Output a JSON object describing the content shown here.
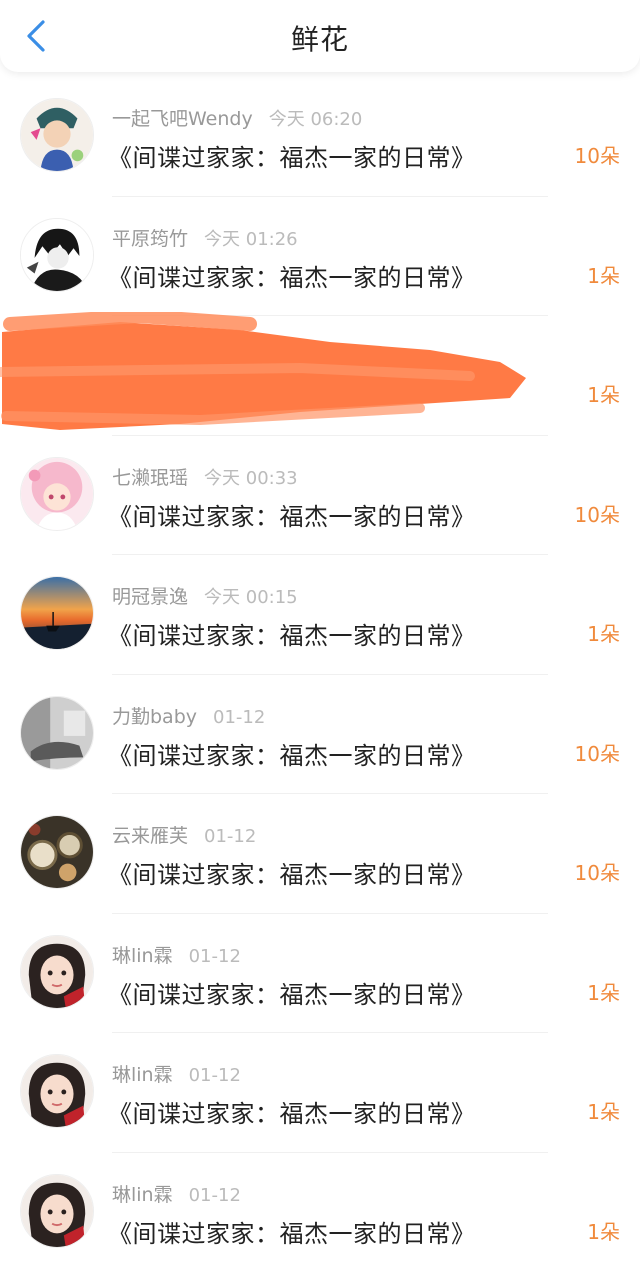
{
  "header": {
    "title": "鲜花",
    "back_icon": "chevron-left-icon"
  },
  "colors": {
    "accent_back": "#3a8ee6",
    "count": "#f08a3c",
    "redaction": "#ff7a45"
  },
  "items": [
    {
      "user": "一起飞吧Wendy",
      "time": "今天 06:20",
      "book": "《间谍过家家：福杰一家的日常》",
      "count": "10朵"
    },
    {
      "user": "平原筠竹",
      "time": "今天 01:26",
      "book": "《间谍过家家：福杰一家的日常》",
      "count": "1朵"
    },
    {
      "user": "",
      "time": "",
      "book": "",
      "count": "1朵"
    },
    {
      "user": "七濑珉瑶",
      "time": "今天 00:33",
      "book": "《间谍过家家：福杰一家的日常》",
      "count": "10朵"
    },
    {
      "user": "明冠景逸",
      "time": "今天 00:15",
      "book": "《间谍过家家：福杰一家的日常》",
      "count": "1朵"
    },
    {
      "user": "力勤baby",
      "time": "01-12",
      "book": "《间谍过家家：福杰一家的日常》",
      "count": "10朵"
    },
    {
      "user": "云来雁芙",
      "time": "01-12",
      "book": "《间谍过家家：福杰一家的日常》",
      "count": "10朵"
    },
    {
      "user": "琳lin霖",
      "time": "01-12",
      "book": "《间谍过家家：福杰一家的日常》",
      "count": "1朵"
    },
    {
      "user": "琳lin霖",
      "time": "01-12",
      "book": "《间谍过家家：福杰一家的日常》",
      "count": "1朵"
    },
    {
      "user": "琳lin霖",
      "time": "01-12",
      "book": "《间谍过家家：福杰一家的日常》",
      "count": "1朵"
    }
  ]
}
